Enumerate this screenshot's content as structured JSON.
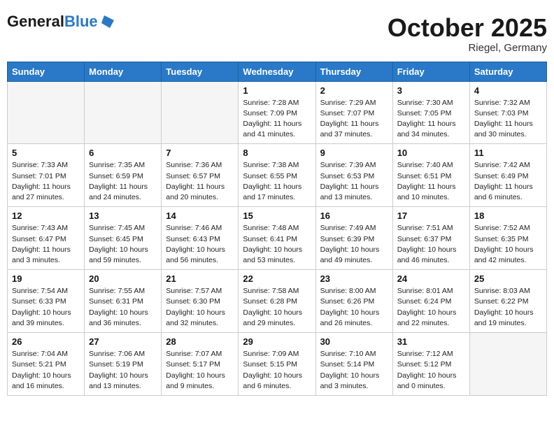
{
  "header": {
    "logo_general": "General",
    "logo_blue": "Blue",
    "month": "October 2025",
    "location": "Riegel, Germany"
  },
  "days_of_week": [
    "Sunday",
    "Monday",
    "Tuesday",
    "Wednesday",
    "Thursday",
    "Friday",
    "Saturday"
  ],
  "weeks": [
    [
      {
        "day": "",
        "sunrise": "",
        "sunset": "",
        "daylight": "",
        "empty": true
      },
      {
        "day": "",
        "sunrise": "",
        "sunset": "",
        "daylight": "",
        "empty": true
      },
      {
        "day": "",
        "sunrise": "",
        "sunset": "",
        "daylight": "",
        "empty": true
      },
      {
        "day": "1",
        "sunrise": "Sunrise: 7:28 AM",
        "sunset": "Sunset: 7:09 PM",
        "daylight": "Daylight: 11 hours and 41 minutes."
      },
      {
        "day": "2",
        "sunrise": "Sunrise: 7:29 AM",
        "sunset": "Sunset: 7:07 PM",
        "daylight": "Daylight: 11 hours and 37 minutes."
      },
      {
        "day": "3",
        "sunrise": "Sunrise: 7:30 AM",
        "sunset": "Sunset: 7:05 PM",
        "daylight": "Daylight: 11 hours and 34 minutes."
      },
      {
        "day": "4",
        "sunrise": "Sunrise: 7:32 AM",
        "sunset": "Sunset: 7:03 PM",
        "daylight": "Daylight: 11 hours and 30 minutes."
      }
    ],
    [
      {
        "day": "5",
        "sunrise": "Sunrise: 7:33 AM",
        "sunset": "Sunset: 7:01 PM",
        "daylight": "Daylight: 11 hours and 27 minutes."
      },
      {
        "day": "6",
        "sunrise": "Sunrise: 7:35 AM",
        "sunset": "Sunset: 6:59 PM",
        "daylight": "Daylight: 11 hours and 24 minutes."
      },
      {
        "day": "7",
        "sunrise": "Sunrise: 7:36 AM",
        "sunset": "Sunset: 6:57 PM",
        "daylight": "Daylight: 11 hours and 20 minutes."
      },
      {
        "day": "8",
        "sunrise": "Sunrise: 7:38 AM",
        "sunset": "Sunset: 6:55 PM",
        "daylight": "Daylight: 11 hours and 17 minutes."
      },
      {
        "day": "9",
        "sunrise": "Sunrise: 7:39 AM",
        "sunset": "Sunset: 6:53 PM",
        "daylight": "Daylight: 11 hours and 13 minutes."
      },
      {
        "day": "10",
        "sunrise": "Sunrise: 7:40 AM",
        "sunset": "Sunset: 6:51 PM",
        "daylight": "Daylight: 11 hours and 10 minutes."
      },
      {
        "day": "11",
        "sunrise": "Sunrise: 7:42 AM",
        "sunset": "Sunset: 6:49 PM",
        "daylight": "Daylight: 11 hours and 6 minutes."
      }
    ],
    [
      {
        "day": "12",
        "sunrise": "Sunrise: 7:43 AM",
        "sunset": "Sunset: 6:47 PM",
        "daylight": "Daylight: 11 hours and 3 minutes."
      },
      {
        "day": "13",
        "sunrise": "Sunrise: 7:45 AM",
        "sunset": "Sunset: 6:45 PM",
        "daylight": "Daylight: 10 hours and 59 minutes."
      },
      {
        "day": "14",
        "sunrise": "Sunrise: 7:46 AM",
        "sunset": "Sunset: 6:43 PM",
        "daylight": "Daylight: 10 hours and 56 minutes."
      },
      {
        "day": "15",
        "sunrise": "Sunrise: 7:48 AM",
        "sunset": "Sunset: 6:41 PM",
        "daylight": "Daylight: 10 hours and 53 minutes."
      },
      {
        "day": "16",
        "sunrise": "Sunrise: 7:49 AM",
        "sunset": "Sunset: 6:39 PM",
        "daylight": "Daylight: 10 hours and 49 minutes."
      },
      {
        "day": "17",
        "sunrise": "Sunrise: 7:51 AM",
        "sunset": "Sunset: 6:37 PM",
        "daylight": "Daylight: 10 hours and 46 minutes."
      },
      {
        "day": "18",
        "sunrise": "Sunrise: 7:52 AM",
        "sunset": "Sunset: 6:35 PM",
        "daylight": "Daylight: 10 hours and 42 minutes."
      }
    ],
    [
      {
        "day": "19",
        "sunrise": "Sunrise: 7:54 AM",
        "sunset": "Sunset: 6:33 PM",
        "daylight": "Daylight: 10 hours and 39 minutes."
      },
      {
        "day": "20",
        "sunrise": "Sunrise: 7:55 AM",
        "sunset": "Sunset: 6:31 PM",
        "daylight": "Daylight: 10 hours and 36 minutes."
      },
      {
        "day": "21",
        "sunrise": "Sunrise: 7:57 AM",
        "sunset": "Sunset: 6:30 PM",
        "daylight": "Daylight: 10 hours and 32 minutes."
      },
      {
        "day": "22",
        "sunrise": "Sunrise: 7:58 AM",
        "sunset": "Sunset: 6:28 PM",
        "daylight": "Daylight: 10 hours and 29 minutes."
      },
      {
        "day": "23",
        "sunrise": "Sunrise: 8:00 AM",
        "sunset": "Sunset: 6:26 PM",
        "daylight": "Daylight: 10 hours and 26 minutes."
      },
      {
        "day": "24",
        "sunrise": "Sunrise: 8:01 AM",
        "sunset": "Sunset: 6:24 PM",
        "daylight": "Daylight: 10 hours and 22 minutes."
      },
      {
        "day": "25",
        "sunrise": "Sunrise: 8:03 AM",
        "sunset": "Sunset: 6:22 PM",
        "daylight": "Daylight: 10 hours and 19 minutes."
      }
    ],
    [
      {
        "day": "26",
        "sunrise": "Sunrise: 7:04 AM",
        "sunset": "Sunset: 5:21 PM",
        "daylight": "Daylight: 10 hours and 16 minutes."
      },
      {
        "day": "27",
        "sunrise": "Sunrise: 7:06 AM",
        "sunset": "Sunset: 5:19 PM",
        "daylight": "Daylight: 10 hours and 13 minutes."
      },
      {
        "day": "28",
        "sunrise": "Sunrise: 7:07 AM",
        "sunset": "Sunset: 5:17 PM",
        "daylight": "Daylight: 10 hours and 9 minutes."
      },
      {
        "day": "29",
        "sunrise": "Sunrise: 7:09 AM",
        "sunset": "Sunset: 5:15 PM",
        "daylight": "Daylight: 10 hours and 6 minutes."
      },
      {
        "day": "30",
        "sunrise": "Sunrise: 7:10 AM",
        "sunset": "Sunset: 5:14 PM",
        "daylight": "Daylight: 10 hours and 3 minutes."
      },
      {
        "day": "31",
        "sunrise": "Sunrise: 7:12 AM",
        "sunset": "Sunset: 5:12 PM",
        "daylight": "Daylight: 10 hours and 0 minutes."
      },
      {
        "day": "",
        "sunrise": "",
        "sunset": "",
        "daylight": "",
        "empty": true
      }
    ]
  ]
}
